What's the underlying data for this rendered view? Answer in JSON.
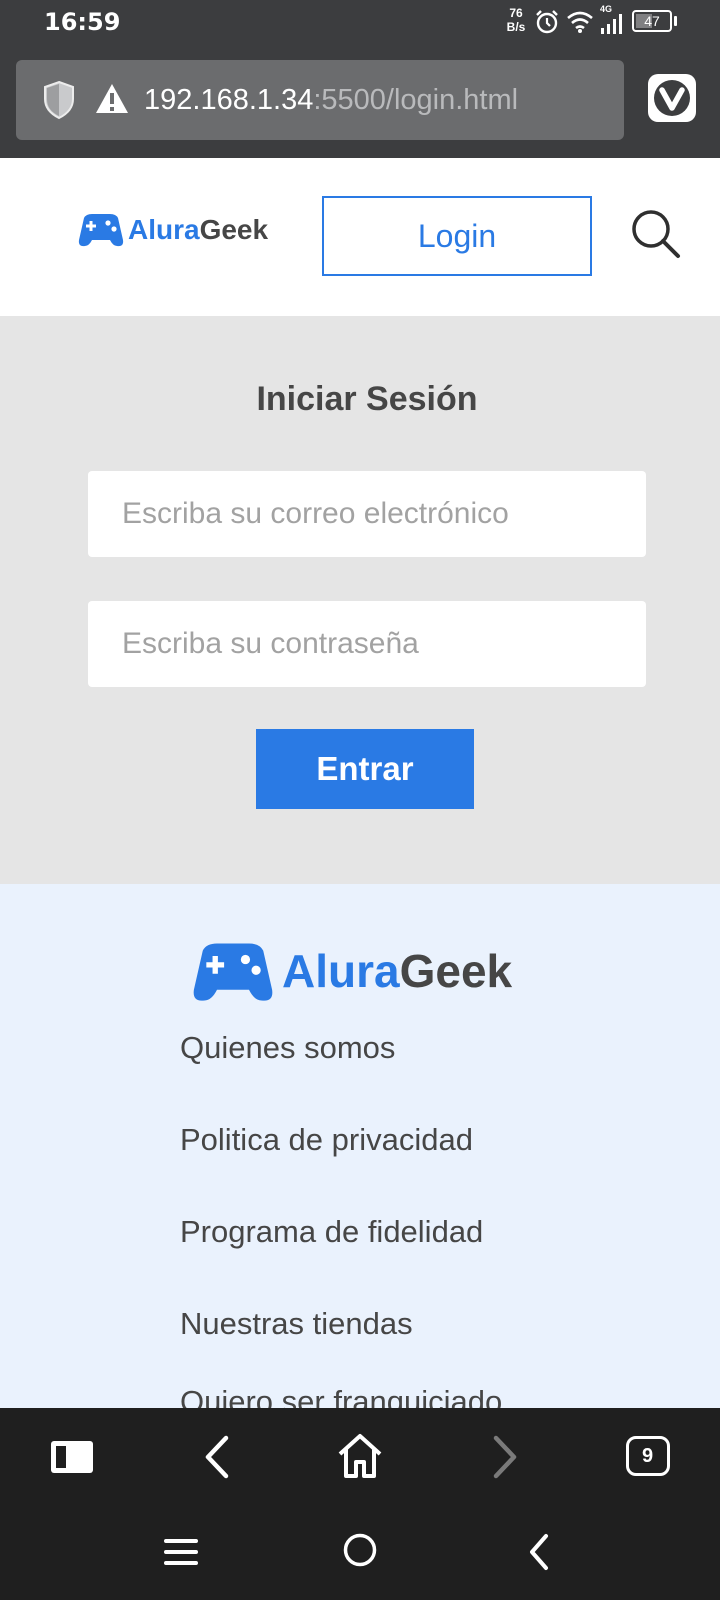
{
  "status_bar": {
    "time": "16:59",
    "network_speed_value": "76",
    "network_speed_unit": "B/s",
    "network_type": "4G",
    "battery": "47"
  },
  "browser": {
    "url_host": "192.168.1.34",
    "url_path": ":5500/login.html",
    "open_tabs": "9"
  },
  "header": {
    "logo_alura": "Alura",
    "logo_geek": "Geek",
    "login_label": "Login"
  },
  "login": {
    "title": "Iniciar Sesión",
    "email_placeholder": "Escriba su correo electrónico",
    "password_placeholder": "Escriba su contraseña",
    "submit_label": "Entrar"
  },
  "footer": {
    "logo_alura": "Alura",
    "logo_geek": "Geek",
    "links": [
      "Quienes somos",
      "Politica de privacidad",
      "Programa de fidelidad",
      "Nuestras tiendas",
      "Quiero ser franquiciado"
    ]
  },
  "colors": {
    "brand_blue": "#2a7ae4",
    "header_bg": "#ffffff",
    "login_bg": "#e5e5e5",
    "footer_bg": "#eaf2fd",
    "status_bar_bg": "#3c3d3f",
    "toolbar_bg": "#1f1f1f"
  },
  "icons": [
    "shield-icon",
    "warning-icon",
    "vivaldi-icon",
    "gamepad-icon",
    "search-icon",
    "panel-icon",
    "back-arrow-icon",
    "home-icon",
    "forward-arrow-icon",
    "tabs-icon",
    "menu-icon",
    "home-circle-icon",
    "nav-back-icon",
    "alarm-icon",
    "wifi-icon",
    "signal-icon",
    "battery-icon"
  ]
}
